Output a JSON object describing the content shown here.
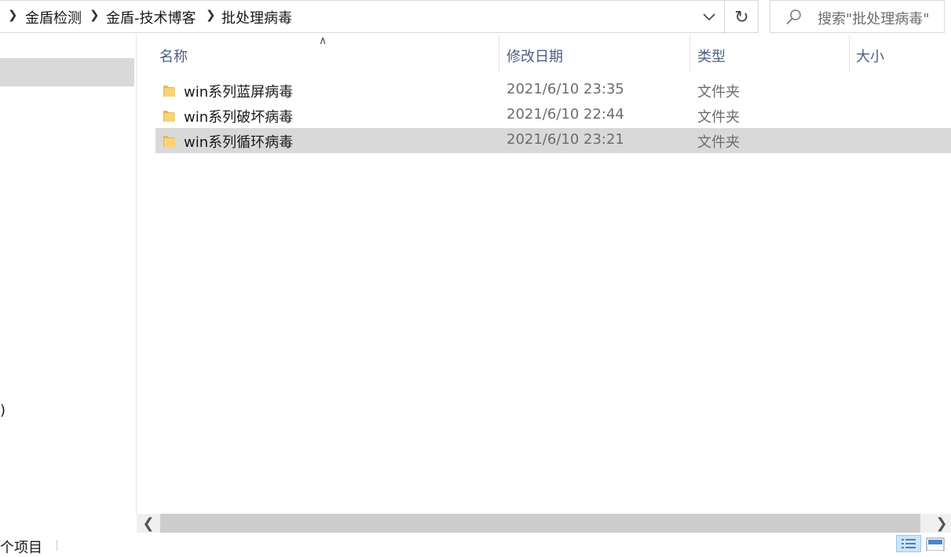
{
  "address_bar": {
    "breadcrumbs": [
      "金盾检测",
      "金盾-技术博客",
      "批处理病毒"
    ]
  },
  "search": {
    "placeholder": "搜索\"批处理病毒\""
  },
  "nav_pane": {
    "partial_text": ")"
  },
  "columns": {
    "name": "名称",
    "date": "修改日期",
    "type": "类型",
    "size": "大小"
  },
  "files": [
    {
      "name": "win系列蓝屏病毒",
      "date": "2021/6/10 23:35",
      "type": "文件夹",
      "selected": false
    },
    {
      "name": "win系列破坏病毒",
      "date": "2021/6/10 22:44",
      "type": "文件夹",
      "selected": false
    },
    {
      "name": "win系列循环病毒",
      "date": "2021/6/10 23:21",
      "type": "文件夹",
      "selected": true
    }
  ],
  "status_bar": {
    "item_count": "个项目"
  },
  "colors": {
    "selection": "#d9d9d9",
    "header_text": "#4d6082",
    "folder": "#f5c542"
  }
}
